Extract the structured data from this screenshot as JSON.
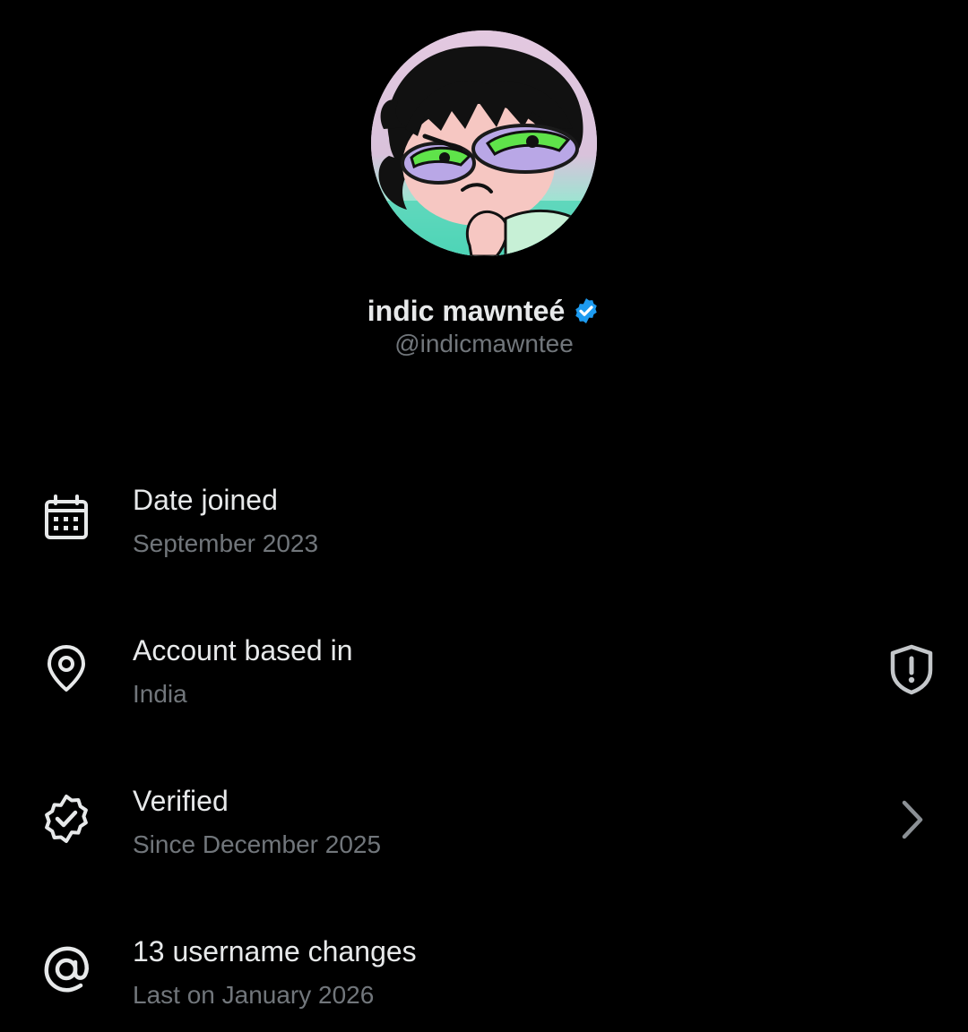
{
  "profile": {
    "display_name": "indic mawnteé",
    "handle": "@indicmawntee",
    "verified_badge_color": "#1d9bf0"
  },
  "rows": [
    {
      "icon": "calendar-icon",
      "title": "Date joined",
      "subtitle": "September 2023"
    },
    {
      "icon": "location-pin-icon",
      "title": "Account based in",
      "subtitle": "India",
      "trailing_icon": "shield-alert-icon"
    },
    {
      "icon": "verified-check-icon",
      "title": "Verified",
      "subtitle": "Since December 2025",
      "trailing_icon": "chevron-right-icon"
    },
    {
      "icon": "at-sign-icon",
      "title": "13 username changes",
      "subtitle": "Last on January 2026"
    }
  ],
  "colors": {
    "background": "#000000",
    "primary_text": "#e7e9ea",
    "secondary_text": "#71767b",
    "accent": "#1d9bf0"
  }
}
